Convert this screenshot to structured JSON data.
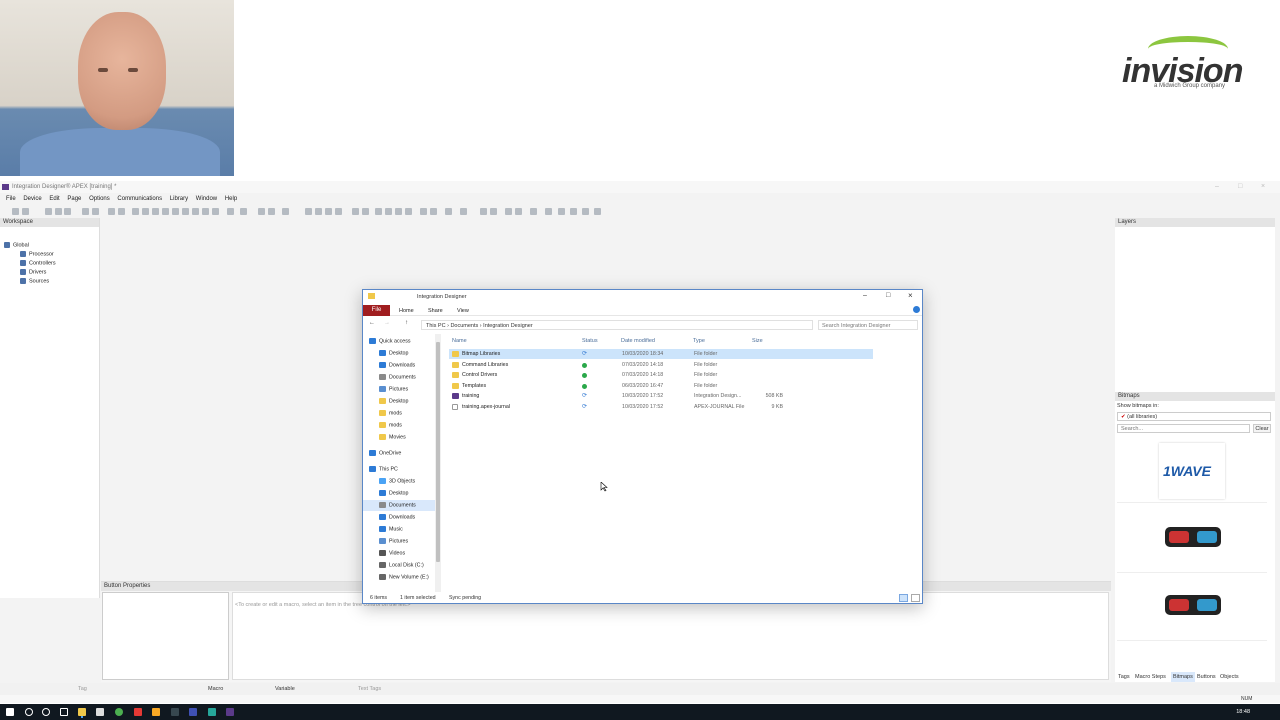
{
  "logo": {
    "word": "invision",
    "tagline": "a Midwich Group company"
  },
  "app": {
    "title": "Integration Designer® APEX [training] *",
    "menu": [
      "File",
      "Device",
      "Edit",
      "Page",
      "Options",
      "Communications",
      "Library",
      "Window",
      "Help"
    ],
    "workspace": {
      "header": "Workspace",
      "tree": [
        "Global",
        "Processor",
        "Controllers",
        "Drivers",
        "Sources"
      ]
    },
    "layers": {
      "header": "Layers"
    },
    "bitmaps": {
      "header": "Bitmaps",
      "show_label": "Show bitmaps in:",
      "library_value": "(all libraries)",
      "search_placeholder": "Search...",
      "clear_label": "Clear",
      "thumb1_text": "1WAVE",
      "tabs": [
        "Tags",
        "Macro Steps",
        "Bitmaps",
        "Buttons",
        "Objects"
      ]
    },
    "button_properties": {
      "header": "Button Properties",
      "macro_hint": "<To create or edit a macro, select an item in the tree control on the left.>"
    },
    "bottombar": {
      "tag_label": "Tag",
      "macro_label": "Macro",
      "variable_label": "Variable",
      "text_tags_label": "Text Tags"
    },
    "status": {
      "num": "NUM"
    }
  },
  "explorer": {
    "title": "Integration Designer",
    "ribbon_tabs": [
      "File",
      "Home",
      "Share",
      "View"
    ],
    "path": [
      "This PC",
      "Documents",
      "Integration Designer"
    ],
    "search_placeholder": "Search Integration Designer",
    "nav": [
      {
        "label": "Quick access",
        "type": "star"
      },
      {
        "label": "Desktop",
        "type": "desk"
      },
      {
        "label": "Downloads",
        "type": "down"
      },
      {
        "label": "Documents",
        "type": "doc"
      },
      {
        "label": "Pictures",
        "type": "pic"
      },
      {
        "label": "Desktop",
        "type": "folder"
      },
      {
        "label": "mods",
        "type": "folder"
      },
      {
        "label": "mods",
        "type": "folder"
      },
      {
        "label": "Movies",
        "type": "folder"
      },
      {
        "label": "OneDrive",
        "type": "cloud"
      },
      {
        "label": "This PC",
        "type": "pc"
      },
      {
        "label": "3D Objects",
        "type": "obj"
      },
      {
        "label": "Desktop",
        "type": "desk"
      },
      {
        "label": "Documents",
        "type": "doc",
        "selected": true
      },
      {
        "label": "Downloads",
        "type": "down"
      },
      {
        "label": "Music",
        "type": "music"
      },
      {
        "label": "Pictures",
        "type": "pic"
      },
      {
        "label": "Videos",
        "type": "vid"
      },
      {
        "label": "Local Disk (C:)",
        "type": "disk"
      },
      {
        "label": "New Volume (E:)",
        "type": "disk"
      }
    ],
    "columns": [
      "Name",
      "Status",
      "Date modified",
      "Type",
      "Size"
    ],
    "files": [
      {
        "name": "Bitmap Libraries",
        "status": "sync",
        "date": "10/03/2020 18:34",
        "type": "File folder",
        "size": "",
        "icon": "folder",
        "selected": true
      },
      {
        "name": "Command Libraries",
        "status": "ok",
        "date": "07/03/2020 14:18",
        "type": "File folder",
        "size": "",
        "icon": "folder"
      },
      {
        "name": "Control Drivers",
        "status": "ok",
        "date": "07/03/2020 14:18",
        "type": "File folder",
        "size": "",
        "icon": "folder"
      },
      {
        "name": "Templates",
        "status": "ok",
        "date": "06/03/2020 16:47",
        "type": "File folder",
        "size": "",
        "icon": "folder"
      },
      {
        "name": "training",
        "status": "sync",
        "date": "10/03/2020 17:52",
        "type": "Integration Design...",
        "size": "508 KB",
        "icon": "apex"
      },
      {
        "name": "training.apex-journal",
        "status": "sync",
        "date": "10/03/2020 17:52",
        "type": "APEX-JOURNAL File",
        "size": "9 KB",
        "icon": "doc"
      }
    ],
    "status": {
      "items": "6 items",
      "selected": "1 item selected",
      "sync": "Sync pending"
    }
  },
  "taskbar": {
    "time": "18:48"
  },
  "colors": {
    "accent": "#a01d1f",
    "select": "#cce4fb",
    "logo_green": "#8cc63f"
  }
}
